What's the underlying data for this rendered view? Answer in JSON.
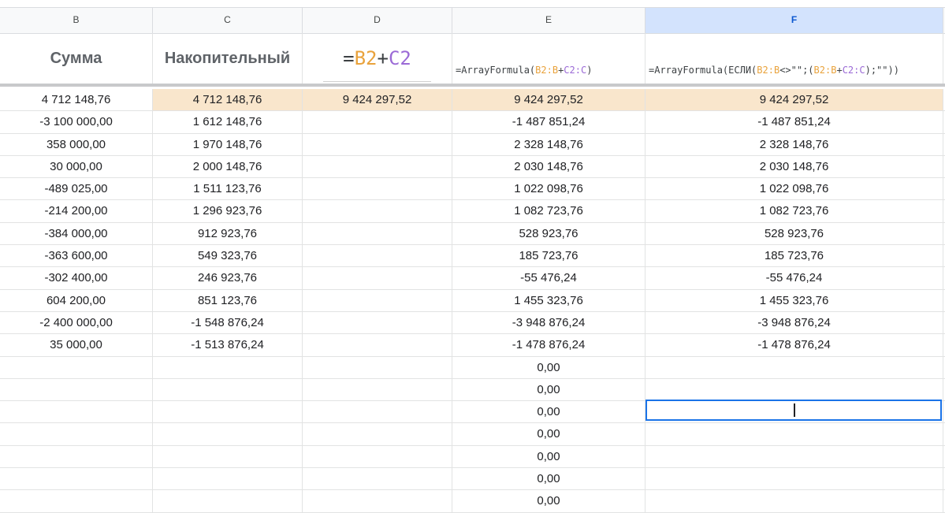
{
  "columns": [
    "B",
    "C",
    "D",
    "E",
    "F"
  ],
  "headers": {
    "b": "Сумма",
    "c": "Накопительный",
    "d_formula": {
      "eq": "=",
      "b2": "B2",
      "plus": "+",
      "c2": "C2"
    },
    "e_formula": {
      "pre": "=ArrayFormula(",
      "b": "B2:B",
      "plus": "+",
      "c": "C2:C",
      "post": ")"
    },
    "f_formula": {
      "pre": "=ArrayFormula(ЕСЛИ(",
      "b": "B2:B",
      "mid1": "<>\"\";(",
      "b2": "B2:B",
      "plus": "+",
      "c": "C2:C",
      "post": ");\"\"))"
    }
  },
  "rows": [
    {
      "b": "4 712 148,76",
      "c": "4 712 148,76",
      "d": "9 424 297,52",
      "e": "9 424 297,52",
      "f": "9 424 297,52"
    },
    {
      "b": "-3 100 000,00",
      "c": "1 612 148,76",
      "d": "",
      "e": "-1 487 851,24",
      "f": "-1 487 851,24"
    },
    {
      "b": "358 000,00",
      "c": "1 970 148,76",
      "d": "",
      "e": "2 328 148,76",
      "f": "2 328 148,76"
    },
    {
      "b": "30 000,00",
      "c": "2 000 148,76",
      "d": "",
      "e": "2 030 148,76",
      "f": "2 030 148,76"
    },
    {
      "b": "-489 025,00",
      "c": "1 511 123,76",
      "d": "",
      "e": "1 022 098,76",
      "f": "1 022 098,76"
    },
    {
      "b": "-214 200,00",
      "c": "1 296 923,76",
      "d": "",
      "e": "1 082 723,76",
      "f": "1 082 723,76"
    },
    {
      "b": "-384 000,00",
      "c": "912 923,76",
      "d": "",
      "e": "528 923,76",
      "f": "528 923,76"
    },
    {
      "b": "-363 600,00",
      "c": "549 323,76",
      "d": "",
      "e": "185 723,76",
      "f": "185 723,76"
    },
    {
      "b": "-302 400,00",
      "c": "246 923,76",
      "d": "",
      "e": "-55 476,24",
      "f": "-55 476,24"
    },
    {
      "b": "604 200,00",
      "c": "851 123,76",
      "d": "",
      "e": "1 455 323,76",
      "f": "1 455 323,76"
    },
    {
      "b": "-2 400 000,00",
      "c": "-1 548 876,24",
      "d": "",
      "e": "-3 948 876,24",
      "f": "-3 948 876,24"
    },
    {
      "b": "35 000,00",
      "c": "-1 513 876,24",
      "d": "",
      "e": "-1 478 876,24",
      "f": "-1 478 876,24"
    },
    {
      "b": "",
      "c": "",
      "d": "",
      "e": "0,00",
      "f": ""
    },
    {
      "b": "",
      "c": "",
      "d": "",
      "e": "0,00",
      "f": ""
    },
    {
      "b": "",
      "c": "",
      "d": "",
      "e": "0,00",
      "f": ""
    },
    {
      "b": "",
      "c": "",
      "d": "",
      "e": "0,00",
      "f": ""
    },
    {
      "b": "",
      "c": "",
      "d": "",
      "e": "0,00",
      "f": ""
    },
    {
      "b": "",
      "c": "",
      "d": "",
      "e": "0,00",
      "f": ""
    },
    {
      "b": "",
      "c": "",
      "d": "",
      "e": "0,00",
      "f": ""
    }
  ],
  "highlight_color": "#f9e6cc",
  "selection_color": "#1a73e8"
}
